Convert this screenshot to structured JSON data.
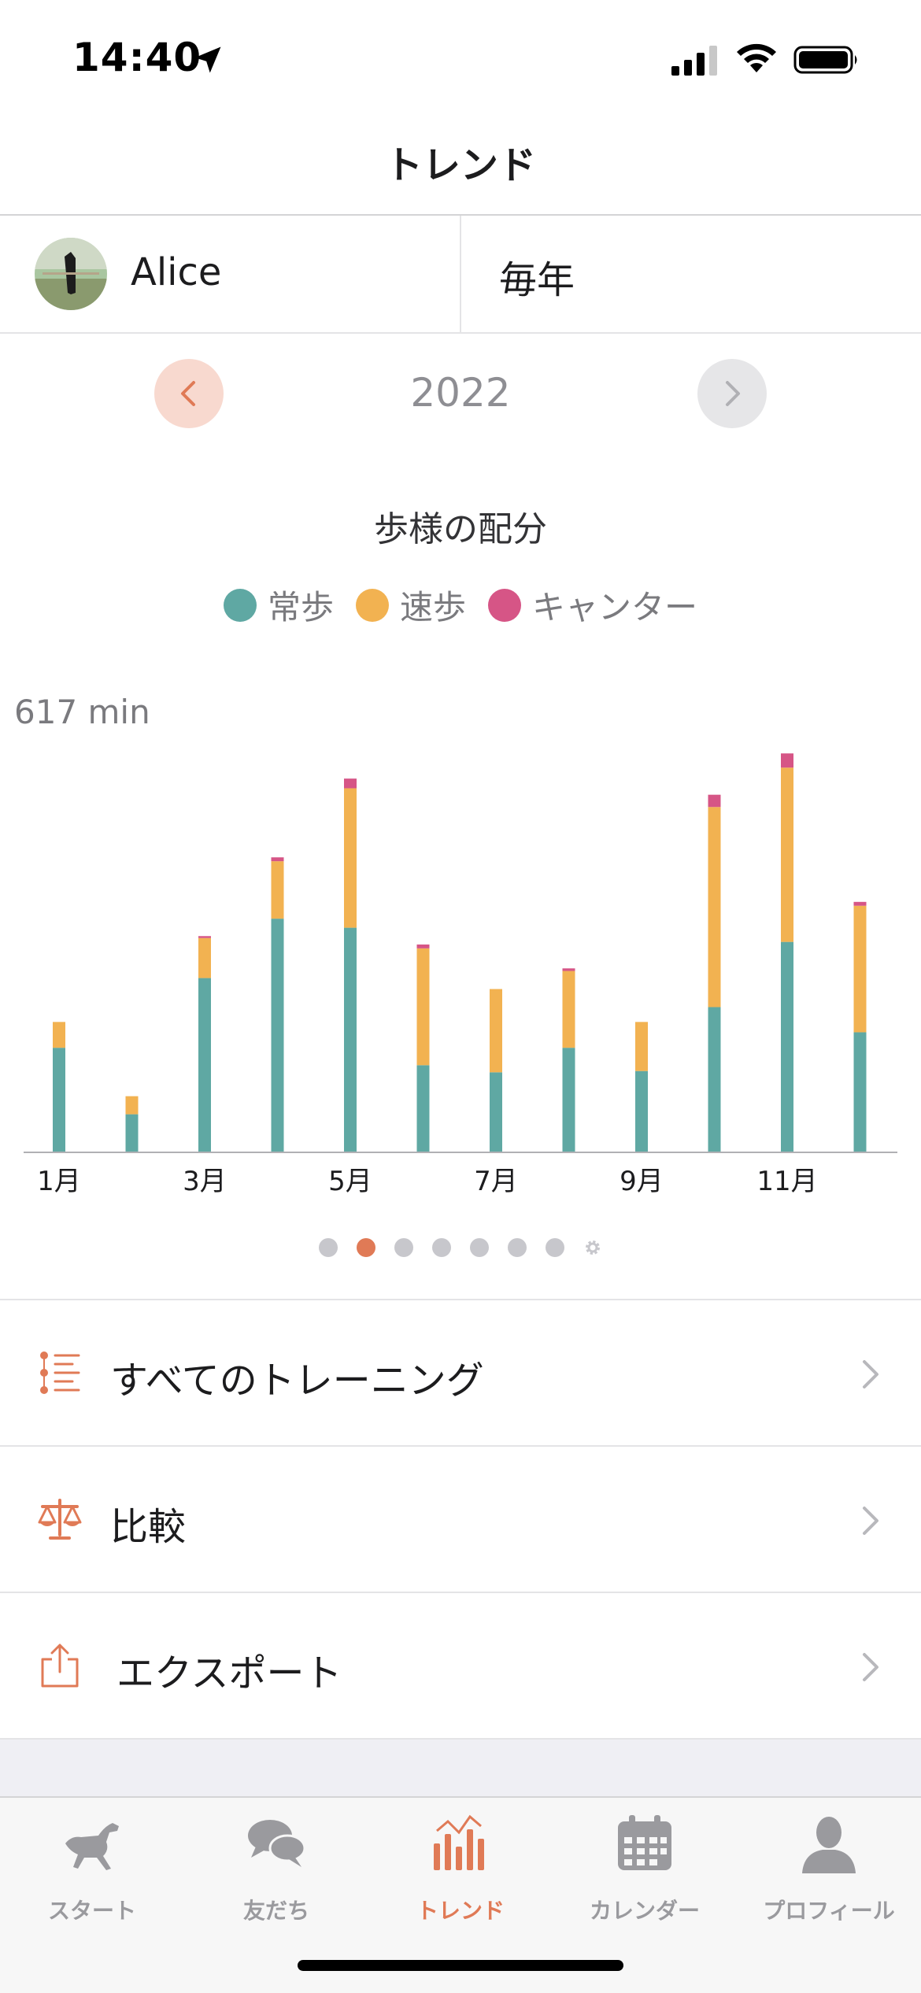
{
  "status": {
    "time": "14:40"
  },
  "nav": {
    "title": "トレンド"
  },
  "selector": {
    "horse_name": "Alice",
    "period": "毎年"
  },
  "year": "2022",
  "chart": {
    "title": "歩様の配分",
    "max_label": "617 min"
  },
  "legend": [
    {
      "label": "常歩",
      "color": "#5fa8a3"
    },
    {
      "label": "速歩",
      "color": "#f2b251"
    },
    {
      "label": "キャンター",
      "color": "#d65586"
    }
  ],
  "chart_data": {
    "type": "bar",
    "stacked": true,
    "title": "歩様の配分",
    "categories": [
      "1月",
      "2月",
      "3月",
      "4月",
      "5月",
      "6月",
      "7月",
      "8月",
      "9月",
      "10月",
      "11月",
      "12月"
    ],
    "tick_labels": [
      "1月",
      "",
      "3月",
      "",
      "5月",
      "",
      "7月",
      "",
      "9月",
      "",
      "11月",
      ""
    ],
    "series": [
      {
        "name": "常歩",
        "color": "#5fa8a3",
        "values": [
          162,
          59,
          270,
          362,
          348,
          135,
          124,
          162,
          126,
          225,
          326,
          186
        ]
      },
      {
        "name": "速歩",
        "color": "#f2b251",
        "values": [
          40,
          28,
          62,
          89,
          216,
          181,
          129,
          119,
          76,
          310,
          270,
          196
        ]
      },
      {
        "name": "キャンター",
        "color": "#d65586",
        "values": [
          0,
          0,
          3,
          6,
          15,
          6,
          0,
          4,
          0,
          19,
          22,
          6
        ]
      }
    ],
    "max_label": "617 min",
    "ylim": [
      0,
      617
    ]
  },
  "page_dots": {
    "count": 7,
    "active_index": 1
  },
  "menu": [
    {
      "label": "すべてのトレーニング",
      "icon": "list-icon"
    },
    {
      "label": "比較",
      "icon": "scale-icon"
    },
    {
      "label": "エクスポート",
      "icon": "share-icon"
    }
  ],
  "tabs": [
    {
      "label": "スタート",
      "icon": "horse-icon",
      "active": false
    },
    {
      "label": "友だち",
      "icon": "chat-bubbles-icon",
      "active": false
    },
    {
      "label": "トレンド",
      "icon": "bar-chart-icon",
      "active": true
    },
    {
      "label": "カレンダー",
      "icon": "calendar-icon",
      "active": false
    },
    {
      "label": "プロフィール",
      "icon": "person-icon",
      "active": false
    }
  ],
  "accent_color": "#e07a56"
}
